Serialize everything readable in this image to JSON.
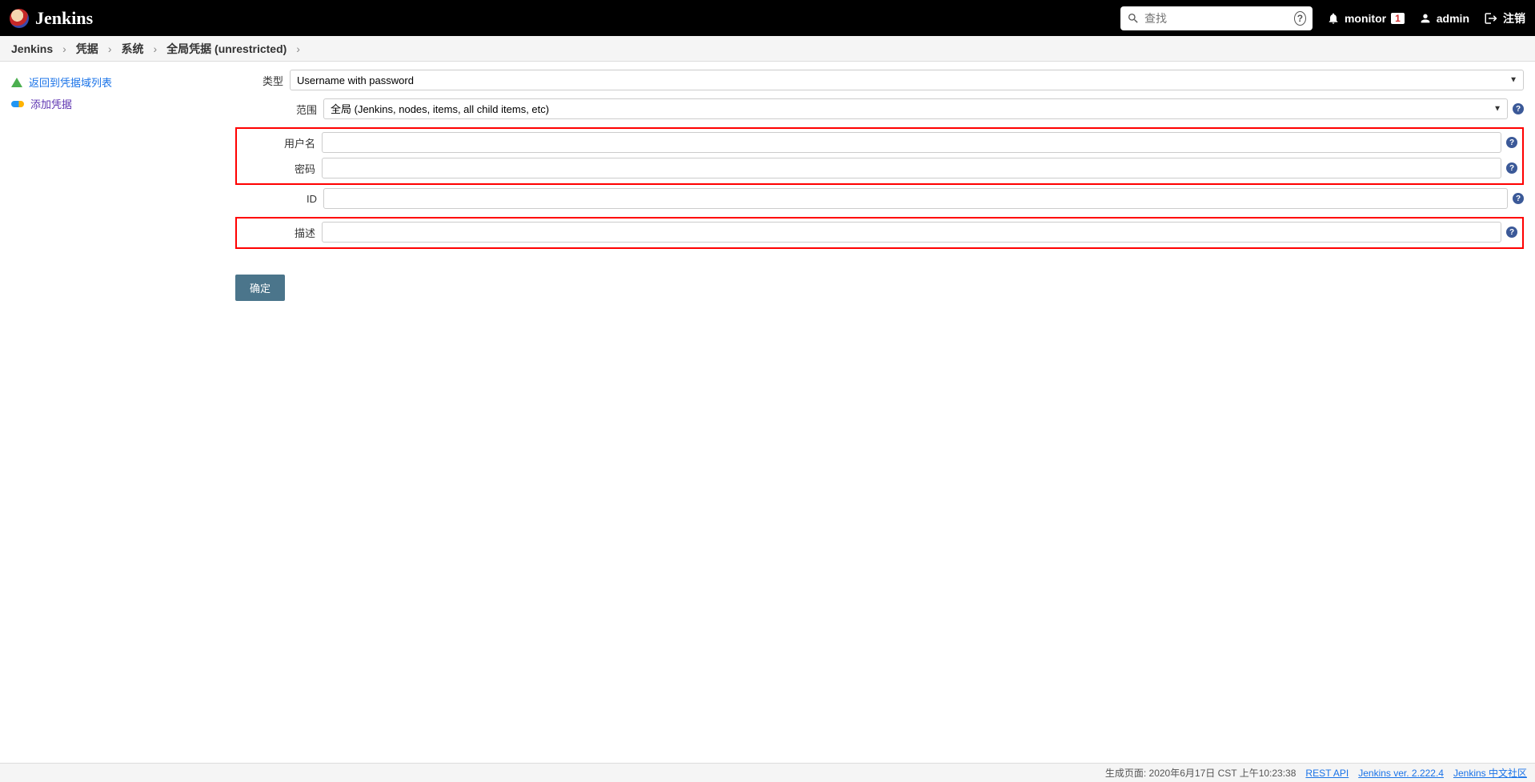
{
  "header": {
    "logo_text": "Jenkins",
    "search_placeholder": "查找",
    "monitor_label": "monitor",
    "monitor_badge": "1",
    "user_label": "admin",
    "logout_label": "注销"
  },
  "breadcrumb": {
    "items": [
      "Jenkins",
      "凭据",
      "系统",
      "全局凭据 (unrestricted)"
    ]
  },
  "sidebar": {
    "back_label": "返回到凭据域列表",
    "add_label": "添加凭据"
  },
  "form": {
    "type_label": "类型",
    "type_value": "Username with password",
    "scope_label": "范围",
    "scope_value": "全局 (Jenkins, nodes, items, all child items, etc)",
    "username_label": "用户名",
    "username_value": "",
    "password_label": "密码",
    "password_value": "",
    "id_label": "ID",
    "id_value": "",
    "description_label": "描述",
    "description_value": "",
    "submit_label": "确定"
  },
  "footer": {
    "generated": "生成页面: 2020年6月17日 CST 上午10:23:38",
    "rest_api": "REST API",
    "version": "Jenkins ver. 2.222.4",
    "community": "Jenkins 中文社区"
  }
}
